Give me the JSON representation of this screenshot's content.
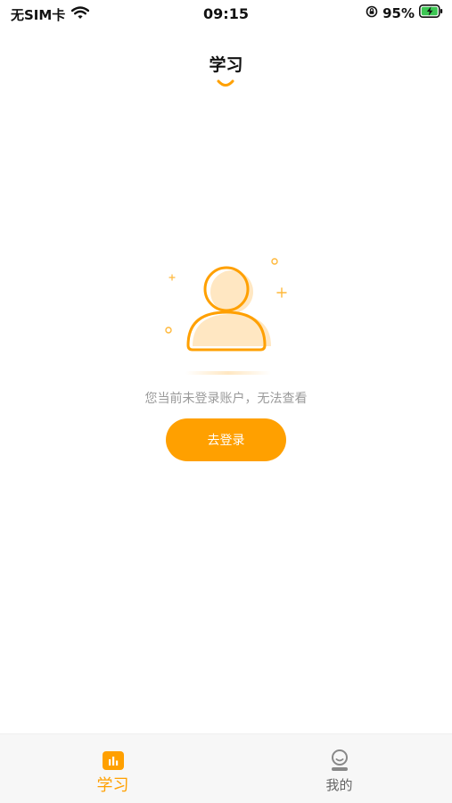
{
  "status_bar": {
    "carrier": "无SIM卡",
    "time": "09:15",
    "battery_percent": "95%",
    "icons": [
      "wifi-icon",
      "rotation-lock-icon",
      "battery-charging-icon"
    ]
  },
  "header": {
    "title": "学习"
  },
  "empty_state": {
    "message": "您当前未登录账户，无法查看",
    "button_label": "去登录",
    "illustration": "user-placeholder-icon"
  },
  "tab_bar": {
    "tabs": [
      {
        "label": "学习",
        "icon": "study-chart-icon",
        "active": true
      },
      {
        "label": "我的",
        "icon": "profile-icon",
        "active": false
      }
    ]
  },
  "colors": {
    "accent": "#ffa000",
    "illustration_fill": "#ffe7c2",
    "muted_text": "#9a9a9a",
    "tab_bar_bg": "#f7f7f7"
  }
}
